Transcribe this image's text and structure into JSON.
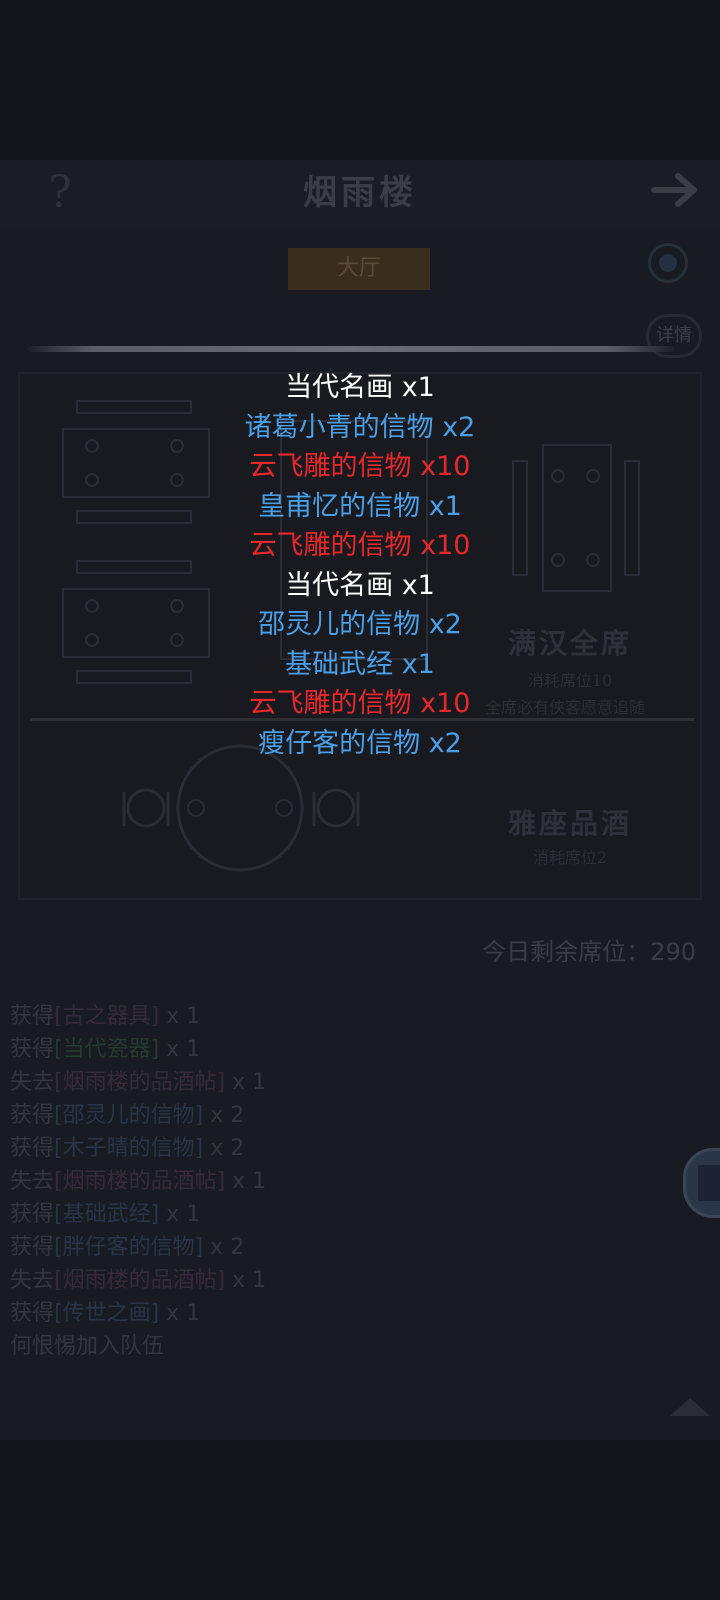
{
  "header": {
    "title": "烟雨楼",
    "help_icon": "?",
    "exit_icon": "arrow-right-icon"
  },
  "tab": {
    "label": "大厅"
  },
  "detail_button": {
    "label": "详情"
  },
  "seats": [
    {
      "title": "满汉全席",
      "cost": "消耗席位10",
      "note": "全席必有侠客愿意追随"
    },
    {
      "title": "雅座品酒",
      "cost": "消耗席位2"
    }
  ],
  "remaining": "今日剩余席位：290",
  "rewards": [
    {
      "text": "当代名画 x1",
      "color": "#ffffff"
    },
    {
      "text": "诸葛小青的信物 x2",
      "color": "#4a9ee6"
    },
    {
      "text": "云飞雕的信物 x10",
      "color": "#e8272a"
    },
    {
      "text": "皇甫忆的信物 x1",
      "color": "#4a9ee6"
    },
    {
      "text": "云飞雕的信物 x10",
      "color": "#e8272a"
    },
    {
      "text": "当代名画 x1",
      "color": "#ffffff"
    },
    {
      "text": "邵灵儿的信物 x2",
      "color": "#4a9ee6"
    },
    {
      "text": "基础武经 x1",
      "color": "#4a9ee6"
    },
    {
      "text": "云飞雕的信物 x10",
      "color": "#e8272a"
    },
    {
      "text": "瘦仔客的信物 x2",
      "color": "#4a9ee6"
    }
  ],
  "log": [
    {
      "verb": "获得",
      "item": "[古之器具]",
      "qty": " x 1",
      "tone": "purple"
    },
    {
      "verb": "获得",
      "item": "[当代瓷器]",
      "qty": " x 1",
      "tone": "green"
    },
    {
      "verb": "失去",
      "item": "[烟雨楼的品酒帖]",
      "qty": " x 1",
      "tone": "purple"
    },
    {
      "verb": "获得",
      "item": "[邵灵儿的信物]",
      "qty": " x 2",
      "tone": "blue"
    },
    {
      "verb": "获得",
      "item": "[木子晴的信物]",
      "qty": " x 2",
      "tone": "blue"
    },
    {
      "verb": "失去",
      "item": "[烟雨楼的品酒帖]",
      "qty": " x 1",
      "tone": "purple"
    },
    {
      "verb": "获得",
      "item": "[基础武经]",
      "qty": " x 1",
      "tone": "blue"
    },
    {
      "verb": "获得",
      "item": "[胖仔客的信物]",
      "qty": " x 2",
      "tone": "blue"
    },
    {
      "verb": "失去",
      "item": "[烟雨楼的品酒帖]",
      "qty": " x 1",
      "tone": "purple"
    },
    {
      "verb": "获得",
      "item": "[传世之画]",
      "qty": " x 1",
      "tone": "blue"
    },
    {
      "verb": "何恨惕加入队伍",
      "item": "",
      "qty": "",
      "tone": ""
    }
  ]
}
